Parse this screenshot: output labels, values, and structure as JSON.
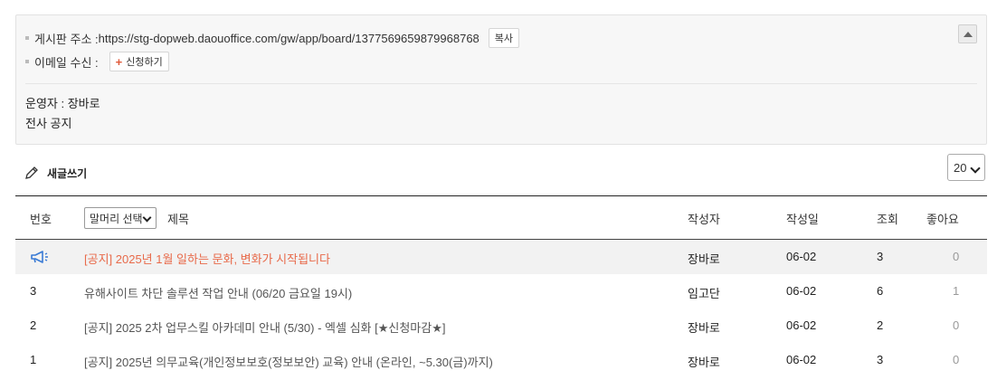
{
  "info": {
    "url_label": "게시판 주소 :",
    "url": "https://stg-dopweb.daouoffice.com/gw/app/board/1377569659879968768",
    "copy_label": "복사",
    "email_label": "이메일 수신 :",
    "subscribe_label": "신청하기",
    "operator": "운영자 : 장바로",
    "description": "전사 공지"
  },
  "toolbar": {
    "write_label": "새글쓰기",
    "page_size": "20"
  },
  "table": {
    "headers": {
      "no": "번호",
      "prefix_select": "말머리 선택",
      "title": "제목",
      "author": "작성자",
      "date": "작성일",
      "views": "조회",
      "likes": "좋아요"
    },
    "rows": [
      {
        "no": "",
        "title": "[공지] 2025년 1월 일하는 문화, 변화가 시작됩니다",
        "author": "장바로",
        "date": "06-02",
        "views": "3",
        "likes": "0",
        "notice": true
      },
      {
        "no": "3",
        "title": "유해사이트 차단 솔루션 작업 안내 (06/20 금요일 19시)",
        "author": "임고단",
        "date": "06-02",
        "views": "6",
        "likes": "1",
        "notice": false
      },
      {
        "no": "2",
        "title": "[공지] 2025 2차 업무스킬 아카데미 안내 (5/30) - 엑셀 심화 [★신청마감★]",
        "author": "장바로",
        "date": "06-02",
        "views": "2",
        "likes": "0",
        "notice": false
      },
      {
        "no": "1",
        "title": "[공지] 2025년 의무교육(개인정보보호(정보보안) 교육) 안내 (온라인, ~5.30(금)까지)",
        "author": "장바로",
        "date": "06-02",
        "views": "3",
        "likes": "0",
        "notice": false
      }
    ]
  },
  "colors": {
    "notice_title": "#e86a4a",
    "notice_icon": "#3a7bd5",
    "notice_row_bg": "#f2f2f2"
  },
  "icons": {
    "notice": "megaphone-icon",
    "write": "pencil-icon",
    "collapse": "chevron-up-icon"
  }
}
